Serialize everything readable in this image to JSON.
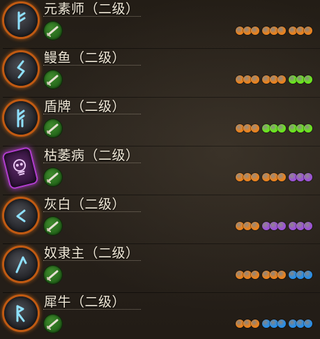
{
  "colors": {
    "orange": "#e8821f",
    "green": "#6ae51e",
    "purple": "#9c53d6",
    "blue": "#2a8ee6"
  },
  "rows": [
    {
      "title": "元素师（二级）",
      "rune_icon": "rune-icon",
      "groups": [
        "orange",
        "orange",
        "orange"
      ]
    },
    {
      "title": "鳗鱼（二级）",
      "rune_icon": "rune-icon",
      "groups": [
        "orange",
        "orange",
        "green"
      ]
    },
    {
      "title": "盾牌（二级）",
      "rune_icon": "rune-icon",
      "groups": [
        "orange",
        "green",
        "green"
      ]
    },
    {
      "title": "枯萎病（二级）",
      "rune_icon": "skull-rune-icon",
      "groups": [
        "orange",
        "orange",
        "purple"
      ]
    },
    {
      "title": "灰白（二级）",
      "rune_icon": "rune-icon",
      "groups": [
        "orange",
        "purple",
        "purple"
      ]
    },
    {
      "title": "奴隶主（二级）",
      "rune_icon": "rune-icon",
      "groups": [
        "orange",
        "orange",
        "blue"
      ]
    },
    {
      "title": "犀牛（二级）",
      "rune_icon": "rune-icon",
      "groups": [
        "orange",
        "blue",
        "blue"
      ]
    }
  ]
}
